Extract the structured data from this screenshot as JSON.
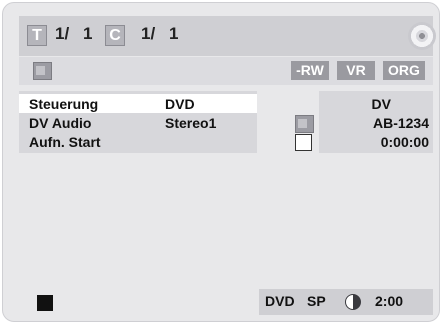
{
  "title_bar": {
    "title_badge": "T",
    "title_value": "1/",
    "title_total": "1",
    "chapter_badge": "C",
    "chapter_value": "1/",
    "chapter_total": "1"
  },
  "format_bar": {
    "tags": [
      "-RW",
      "VR",
      "ORG"
    ]
  },
  "menu": {
    "rows": [
      {
        "label": "Steuerung",
        "value": "DVD"
      },
      {
        "label": "DV Audio",
        "value": "Stereo1"
      },
      {
        "label": "Aufn. Start",
        "value": ""
      }
    ]
  },
  "dv_info": {
    "label": "DV",
    "tape_id": "AB-1234",
    "time": "0:00:00"
  },
  "status": {
    "media": "DVD",
    "mode": "SP",
    "remaining": "2:00",
    "remaining_fraction": 0.5
  },
  "icons": {
    "disc": "disc-icon",
    "camcorder": "camcorder-icon",
    "stop": "stop-icon",
    "remaining": "pie-remaining-icon",
    "checkbox": "checkbox-icon"
  }
}
